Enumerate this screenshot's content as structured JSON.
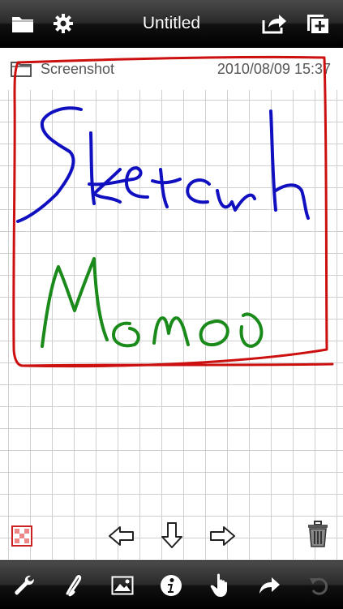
{
  "topbar": {
    "title": "Untitled",
    "left_icons": [
      "folder-icon",
      "gear-icon"
    ],
    "right_icons": [
      "share-icon",
      "new-page-icon"
    ]
  },
  "note": {
    "folder": "Screenshot",
    "datetime": "2010/08/09 15:37",
    "handwriting": [
      "Sketch",
      "Memo"
    ]
  },
  "colors": {
    "ink_blue": "#1010c0",
    "ink_green": "#1a8a1a",
    "ink_red": "#cc1010",
    "grid": "#cfcfcf",
    "bar_dark": "#111111"
  },
  "paper_controls": [
    "eraser-icon",
    "arrow-left-icon",
    "arrow-down-icon",
    "arrow-right-icon",
    "trash-icon"
  ],
  "toolbar": {
    "items": [
      "wrench-icon",
      "pen-style-icon",
      "image-icon",
      "info-icon",
      "hand-icon",
      "redo-icon",
      "undo-icon"
    ]
  }
}
